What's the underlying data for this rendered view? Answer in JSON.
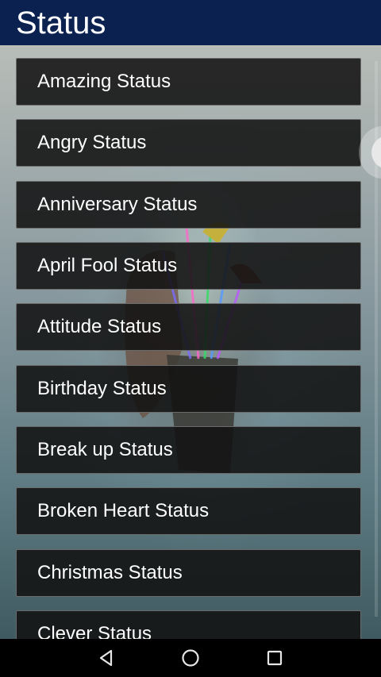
{
  "app_bar": {
    "title": "Status"
  },
  "status_list": [
    "Amazing Status",
    "Angry Status",
    "Anniversary Status",
    "April Fool Status",
    "Attitude Status",
    "Birthday Status",
    "Break up Status",
    "Broken Heart Status",
    "Christmas Status",
    "Clever Status"
  ],
  "nav": {
    "back_icon": "back-triangle-icon",
    "home_icon": "home-circle-icon",
    "recents_icon": "recents-square-icon"
  },
  "colors": {
    "app_bar": "#0b2150",
    "item_bg": "#121212",
    "nav_bg": "#000000"
  }
}
